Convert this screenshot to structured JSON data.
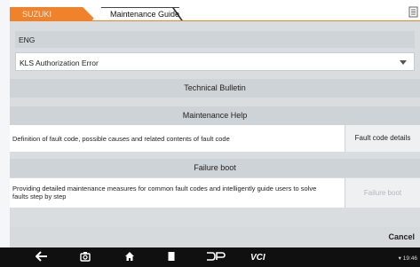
{
  "tabs": {
    "brand": "SUZUKI",
    "guide": "Maintenance Guide"
  },
  "language": "ENG",
  "error_select": {
    "value": "KLS Authorization Error"
  },
  "sections": {
    "technical_bulletin": "Technical Bulletin",
    "maintenance_help": "Maintenance Help",
    "failure_boot": "Failure boot"
  },
  "maintenance_help_row": {
    "description": "Definition of fault code, possible causes and related contents of fault code",
    "button": "Fault code details"
  },
  "failure_boot_row": {
    "description": "Providing detailed maintenance measures for common fault codes and intelligently guide users to solve faults step by step",
    "button": "Failure boot"
  },
  "footer": {
    "cancel": "Cancel"
  },
  "status": {
    "time": "19:46"
  },
  "nav_icons": [
    "back-icon",
    "camera-icon",
    "home-icon",
    "recent-apps-icon",
    "dp-icon",
    "vci-icon"
  ],
  "colors": {
    "accent": "#f0822c",
    "disabled_text": "#b4b8bb"
  }
}
